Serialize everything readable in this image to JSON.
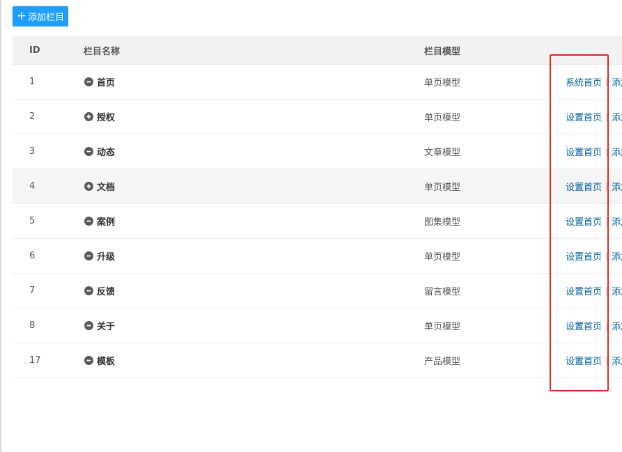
{
  "toolbar": {
    "add_label": "添加栏目"
  },
  "table": {
    "headers": {
      "id": "ID",
      "name": "栏目名称",
      "model": "栏目模型"
    },
    "rows": [
      {
        "id": "1",
        "name": "首页",
        "state": "collapse",
        "model": "单页模型",
        "op1": "系统首页",
        "op2": "添加"
      },
      {
        "id": "2",
        "name": "授权",
        "state": "expand",
        "model": "单页模型",
        "op1": "设置首页",
        "op2": "添加"
      },
      {
        "id": "3",
        "name": "动态",
        "state": "collapse",
        "model": "文章模型",
        "op1": "设置首页",
        "op2": "添加"
      },
      {
        "id": "4",
        "name": "文档",
        "state": "expand",
        "model": "单页模型",
        "op1": "设置首页",
        "op2": "添加"
      },
      {
        "id": "5",
        "name": "案例",
        "state": "collapse",
        "model": "图集模型",
        "op1": "设置首页",
        "op2": "添加"
      },
      {
        "id": "6",
        "name": "升级",
        "state": "collapse",
        "model": "单页模型",
        "op1": "设置首页",
        "op2": "添加"
      },
      {
        "id": "7",
        "name": "反馈",
        "state": "collapse",
        "model": "留言模型",
        "op1": "设置首页",
        "op2": "添加"
      },
      {
        "id": "8",
        "name": "关于",
        "state": "collapse",
        "model": "单页模型",
        "op1": "设置首页",
        "op2": "添加"
      },
      {
        "id": "17",
        "name": "模板",
        "state": "collapse",
        "model": "产品模型",
        "op1": "设置首页",
        "op2": "添加"
      }
    ]
  },
  "colors": {
    "accent": "#1e9fff",
    "link": "#01619a",
    "highlight_box": "#e0281e"
  }
}
